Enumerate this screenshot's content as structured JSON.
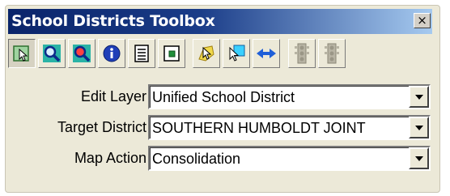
{
  "window": {
    "title": "School Districts Toolbox",
    "close_glyph": "×"
  },
  "toolbar": {
    "buttons": [
      {
        "name": "select-feature-icon",
        "pressed": true
      },
      {
        "name": "zoom-in-icon",
        "pressed": false
      },
      {
        "name": "zoom-out-icon",
        "pressed": false
      },
      {
        "name": "identify-icon",
        "pressed": false
      },
      {
        "name": "attribute-table-icon",
        "pressed": false
      },
      {
        "name": "layer-properties-icon",
        "pressed": false
      },
      {
        "name": "select-by-attribute-icon",
        "pressed": false
      },
      {
        "name": "select-by-location-icon",
        "pressed": false
      },
      {
        "name": "merge-icon",
        "pressed": false
      },
      {
        "name": "traffic-light-icon",
        "pressed": false
      },
      {
        "name": "traffic-light-disabled-icon",
        "pressed": false
      }
    ]
  },
  "form": {
    "edit_layer": {
      "label": "Edit Layer",
      "value": "Unified School District"
    },
    "target_district": {
      "label": "Target District",
      "value": "SOUTHERN HUMBOLDT JOINT"
    },
    "map_action": {
      "label": "Map Action",
      "value": "Consolidation"
    }
  },
  "colors": {
    "title_gradient_start": "#0a246a",
    "title_gradient_end": "#a6caf0",
    "face": "#ece9d8"
  }
}
